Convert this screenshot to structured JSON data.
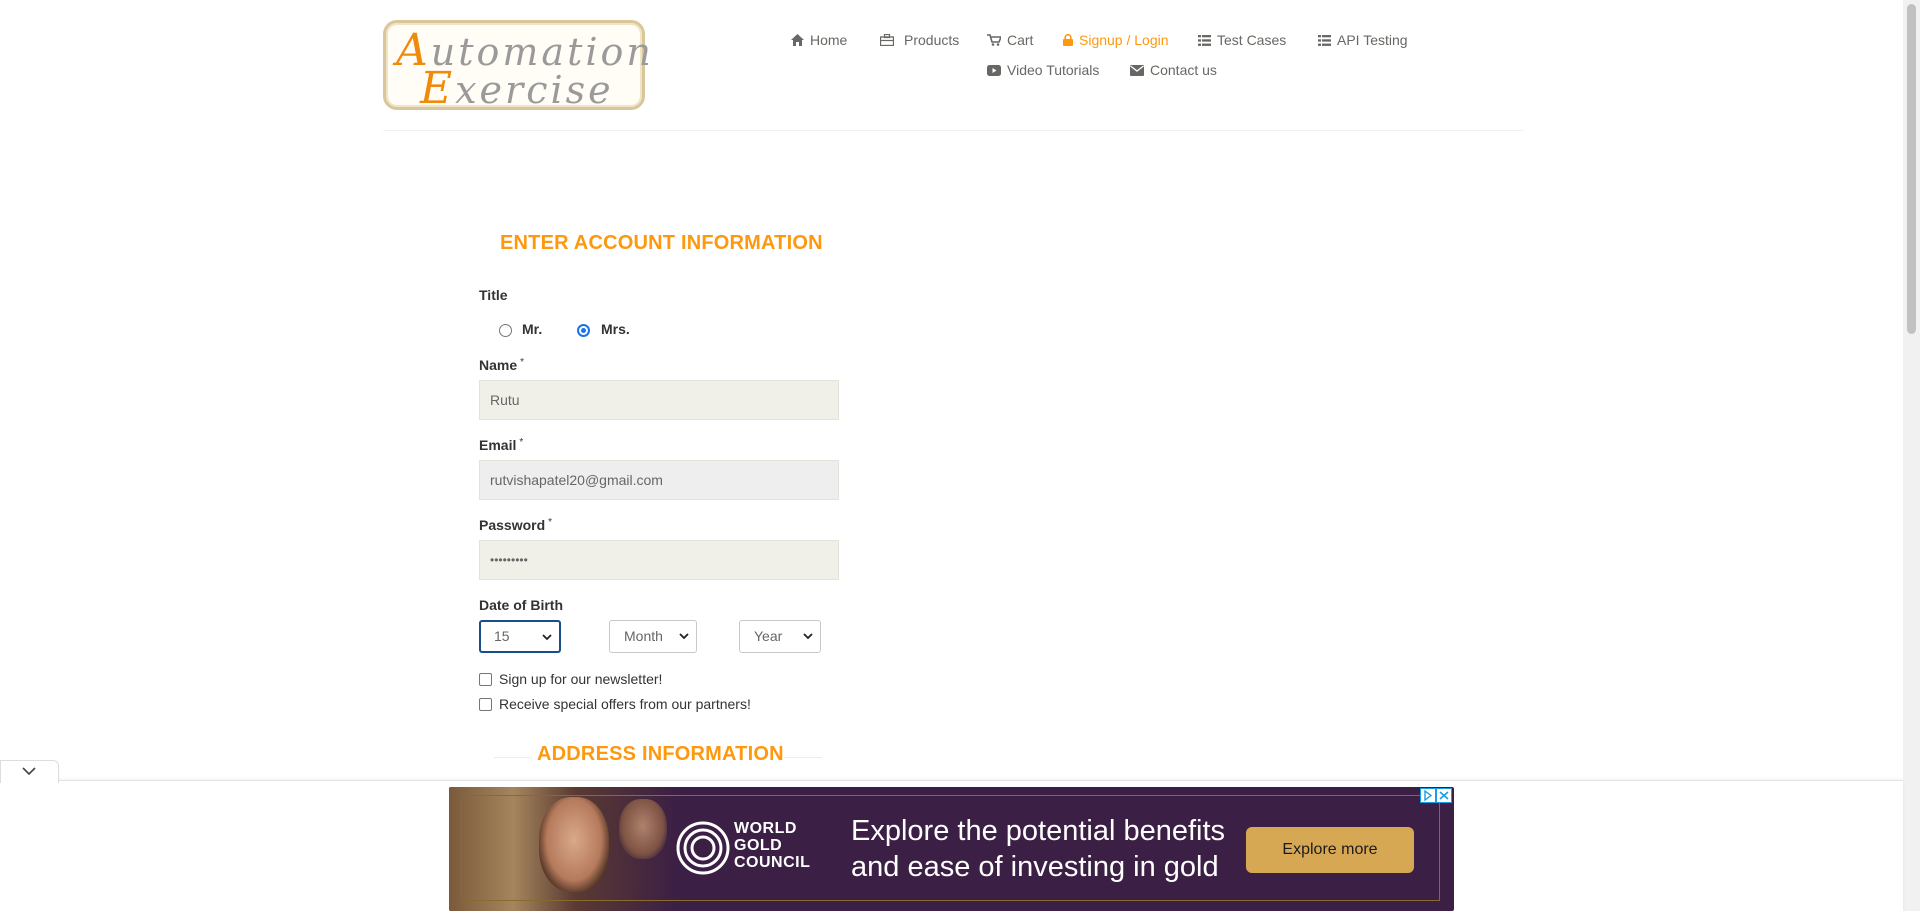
{
  "header": {
    "logo_text": "Automation Exercise",
    "nav": [
      {
        "label": "Home",
        "icon": "home-icon"
      },
      {
        "label": "Products",
        "icon": "product-icon"
      },
      {
        "label": "Cart",
        "icon": "cart-icon"
      },
      {
        "label": "Signup / Login",
        "icon": "lock-icon",
        "active": true
      },
      {
        "label": "Test Cases",
        "icon": "list-icon"
      },
      {
        "label": "API Testing",
        "icon": "list-icon"
      },
      {
        "label": "Video Tutorials",
        "icon": "youtube-icon"
      },
      {
        "label": "Contact us",
        "icon": "envelope-icon"
      }
    ]
  },
  "form": {
    "title": "ENTER ACCOUNT INFORMATION",
    "title_label": "Title",
    "title_options": [
      {
        "label": "Mr.",
        "checked": false
      },
      {
        "label": "Mrs.",
        "checked": true
      }
    ],
    "name_label": "Name",
    "name_value": "Rutu",
    "email_label": "Email",
    "email_value": "rutvishapatel20@gmail.com",
    "password_label": "Password",
    "password_value": "•••••••••",
    "required_mark": "*",
    "dob_label": "Date of Birth",
    "dob_day": "15",
    "dob_month": "Month",
    "dob_year": "Year",
    "newsletter_label": "Sign up for our newsletter!",
    "newsletter_checked": false,
    "offers_label": "Receive special offers from our partners!",
    "offers_checked": false,
    "address_title": "ADDRESS INFORMATION"
  },
  "ad": {
    "brand_line1": "WORLD",
    "brand_line2": "GOLD",
    "brand_line3": "COUNCIL",
    "copy_line1": "Explore the potential benefits",
    "copy_line2": "and ease of investing in gold",
    "cta": "Explore more"
  },
  "colors": {
    "accent": "#FE980F",
    "ad_background": "#3B1F45",
    "ad_button": "#D7A853"
  }
}
